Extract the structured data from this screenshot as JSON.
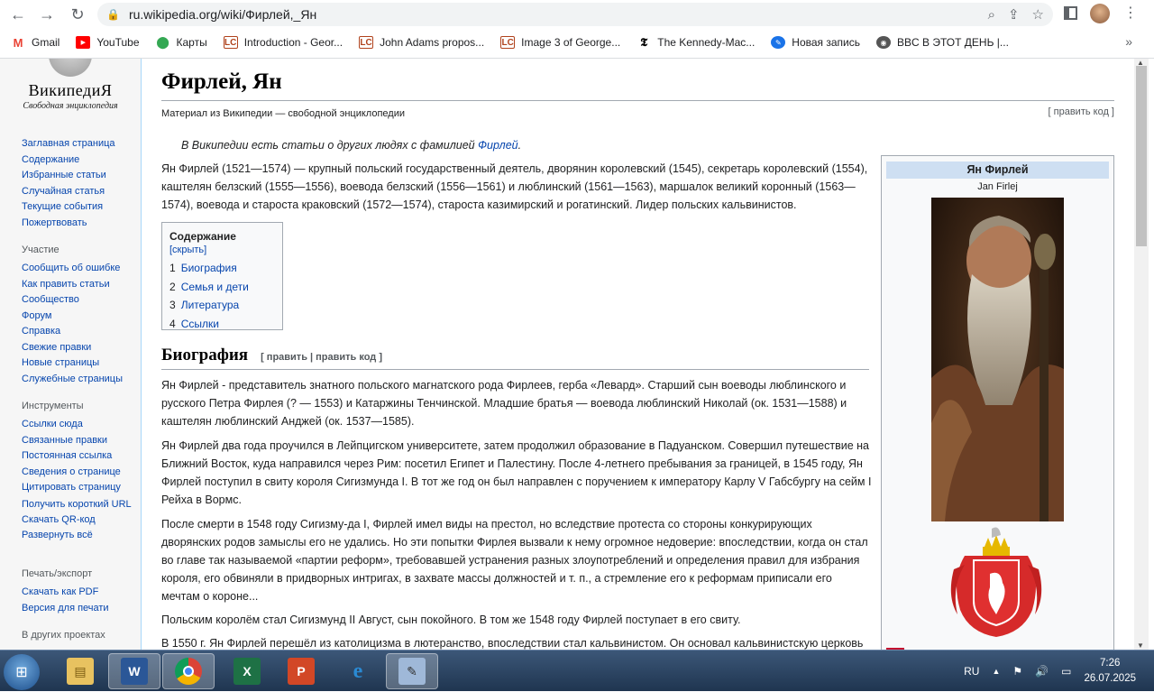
{
  "browser": {
    "url": "ru.wikipedia.org/wiki/Фирлей,_Ян",
    "bookmarks": [
      "Gmail",
      "YouTube",
      "Карты",
      "Introduction - Geor...",
      "John Adams propos...",
      "Image 3 of George...",
      "The Kennedy-Mac...",
      "Новая запись",
      "BBC В ЭТОТ ДЕНЬ |..."
    ]
  },
  "logo": {
    "name": "ВикипедиЯ",
    "sub": "Свободная энциклопедия"
  },
  "sidebar": {
    "main": [
      "Заглавная страница",
      "Содержание",
      "Избранные статьи",
      "Случайная статья",
      "Текущие события",
      "Пожертвовать"
    ],
    "participation_title": "Участие",
    "participation": [
      "Сообщить об ошибке",
      "Как править статьи",
      "Сообщество",
      "Форум",
      "Справка",
      "Свежие правки",
      "Новые страницы",
      "Служебные страницы"
    ],
    "tools_title": "Инструменты",
    "tools": [
      "Ссылки сюда",
      "Связанные правки",
      "Постоянная ссылка",
      "Сведения о странице",
      "Цитировать страницу",
      "Получить короткий URL",
      "Скачать QR-код",
      "Развернуть всё"
    ],
    "print_title": "Печать/экспорт",
    "print": [
      "Скачать как PDF",
      "Версия для печати"
    ],
    "other_title": "В других проектах"
  },
  "article": {
    "title": "Фирлей, Ян",
    "tagline": "Материал из Википедии — свободной энциклопедии",
    "edit_code": "[ править код ]",
    "hatnote_text": "В Википедии есть статьи о других людях с фамилией ",
    "hatnote_link": "Фирлей",
    "lead": "Ян Фирлей (1521—1574) — крупный польский государственный деятель, дворянин королевский (1545), секретарь королевский (1554), каштелян белзский (1555—1556), воевода белзский (1556—1561) и люблинский (1561—1563), маршалок великий коронный (1563—1574), воевода и староста краковский (1572—1574), староста казимирский и рогатинский. Лидер польских кальвинистов.",
    "toc": {
      "title": "Содержание",
      "hide": "[скрыть]",
      "items": [
        {
          "num": "1",
          "label": "Биография"
        },
        {
          "num": "2",
          "label": "Семья и дети"
        },
        {
          "num": "3",
          "label": "Литература"
        },
        {
          "num": "4",
          "label": "Ссылки"
        }
      ]
    },
    "h2": "Биография",
    "h2_edit": "[ править | править код ]",
    "p1": "Ян Фирлей - представитель знатного польского магнатского рода Фирлеев, герба «Левард». Старший сын воеводы люблинского и русского Петра Фирлея (? — 1553) и Катаржины Тенчинской. Младшие братья — воевода люблинский Николай (ок. 1531—1588) и каштелян люблинский Анджей (ок. 1537—1585).",
    "p2": "Ян Фирлей два года проучился в Лейпцигском университете, затем продолжил образование в Падуанском. Совершил путешествие на Ближний Восток, куда направился через Рим: посетил Египет и Палестину. После 4-летнего пребывания за границей, в 1545 году, Ян Фирлей поступил в свиту короля Сигизмунда I. В тот же год он был направлен с поручением к императору Карлу V Габсбургу на сейм I Рейха в Вормс.",
    "p3": "После смерти в 1548 году Сигизму-да I, Фирлей имел виды на престол, но вследствие протеста со стороны конкурирующих дворянских родов замыслы его не удались. Но эти попытки Фирлея вызвали к нему огромное недоверие: впоследствии, когда он стал во главе так называемой «партии реформ», требовавшей устранения разных злоупотреблений и определения правил для избрания короля, его обвиняли в придворных интригах, в захвате массы должностей и т. п., а стремление его к реформам приписали его мечтам о короне...",
    "p4": "Польским королём стал Сигизмунд II Август, сын покойного. В том же 1548 году Фирлей поступает в его свиту.",
    "p5": "В 1550 г. Ян Фирлей перешёл из католицизма в лютеранство, впоследствии стал кальвинистом. Он основал кальвинистскую церковь"
  },
  "infobox": {
    "title": "Ян Фирлей",
    "subtitle": "Jan Firlej"
  },
  "taskbar": {
    "lang": "RU",
    "time": "7:26",
    "date": "26.07.2025"
  },
  "colors": {
    "link": "#0645ad",
    "infobox_header": "#cedff2",
    "taskbar": "#2b4566"
  }
}
